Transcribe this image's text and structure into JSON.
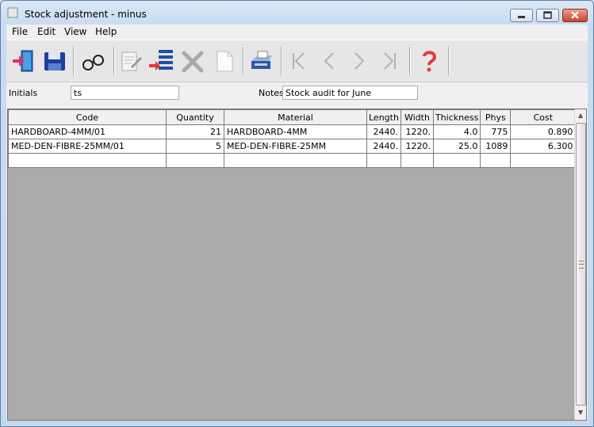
{
  "window": {
    "title": "Stock adjustment - minus",
    "controls": {
      "minimize": "minimize-button",
      "maximize": "maximize-button",
      "close": "close-button"
    }
  },
  "menu": [
    "File",
    "Edit",
    "View",
    "Help"
  ],
  "toolbar": {
    "buttons": [
      "exit-door-icon",
      "save-disk-icon",
      "find-glasses-icon",
      "edit-document-icon",
      "insert-row-icon",
      "delete-x-icon",
      "new-page-icon",
      "print-icon",
      "first-record-icon",
      "prev-record-icon",
      "next-record-icon",
      "last-record-icon",
      "help-question-icon"
    ]
  },
  "form": {
    "initials_label": "Initials",
    "initials_value": "ts",
    "notes_label": "Notes",
    "notes_value": "Stock audit for June"
  },
  "grid": {
    "columns": [
      "Code",
      "Quantity",
      "Material",
      "Length",
      "Width",
      "Thickness",
      "Phys",
      "Cost"
    ],
    "rows": [
      {
        "code": "HARDBOARD-4MM/01",
        "quantity": "21",
        "material": "HARDBOARD-4MM",
        "length": "2440.",
        "width": "1220.",
        "thickness": "4.0",
        "phys": "775",
        "cost": "0.890"
      },
      {
        "code": "MED-DEN-FIBRE-25MM/01",
        "quantity": "5",
        "material": "MED-DEN-FIBRE-25MM",
        "length": "2440.",
        "width": "1220.",
        "thickness": "25.0",
        "phys": "1089",
        "cost": "6.300"
      },
      {
        "code": "",
        "quantity": "",
        "material": "",
        "length": "",
        "width": "",
        "thickness": "",
        "phys": "",
        "cost": ""
      }
    ]
  },
  "colors": {
    "accent_red": "#e23c3c",
    "toolbar_blue": "#1f4fa8"
  }
}
